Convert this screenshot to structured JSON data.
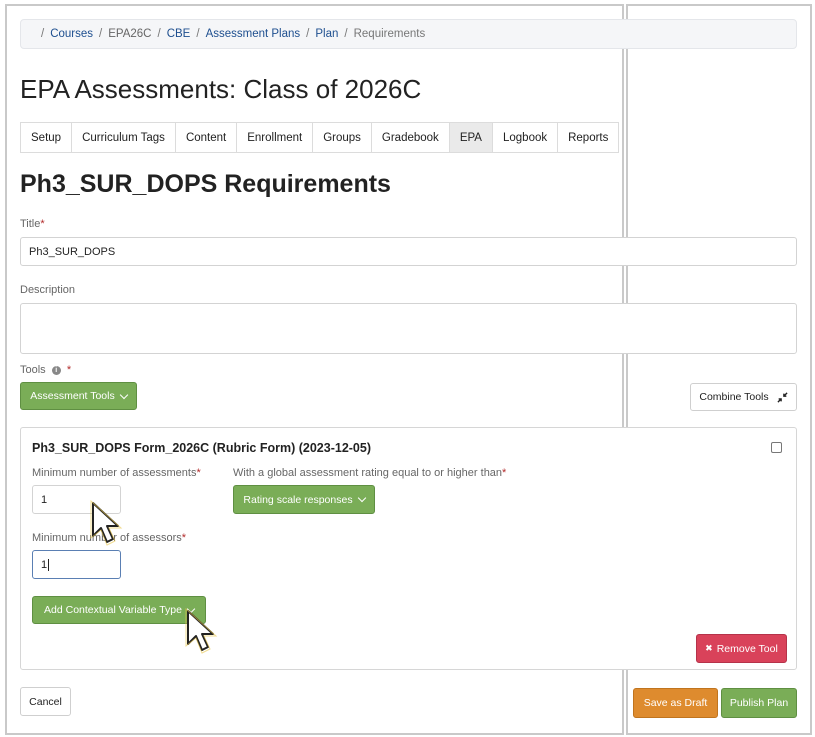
{
  "breadcrumb": {
    "items": [
      "Courses",
      "EPA26C",
      "CBE",
      "Assessment Plans",
      "Plan",
      "Requirements"
    ]
  },
  "page_title": "EPA Assessments: Class of 2026C",
  "tabs": [
    {
      "label": "Setup"
    },
    {
      "label": "Curriculum Tags"
    },
    {
      "label": "Content"
    },
    {
      "label": "Enrollment"
    },
    {
      "label": "Groups"
    },
    {
      "label": "Gradebook"
    },
    {
      "label": "EPA",
      "active": true
    },
    {
      "label": "Logbook"
    },
    {
      "label": "Reports"
    }
  ],
  "section_title": "Ph3_SUR_DOPS Requirements",
  "form": {
    "title_label": "Title",
    "title_value": "Ph3_SUR_DOPS",
    "description_label": "Description",
    "description_value": "",
    "tools_label": "Tools",
    "required_mark": "*",
    "info_glyph": "i"
  },
  "toolbar": {
    "assessment_tools_label": "Assessment Tools",
    "combine_tools_label": "Combine Tools"
  },
  "tool_card": {
    "title": "Ph3_SUR_DOPS Form_2026C (Rubric Form) (2023-12-05)",
    "min_assessments_label": "Minimum number of assessments",
    "min_assessments_value": "1",
    "global_rating_label": "With a global assessment rating equal to or higher than",
    "rating_button_label": "Rating scale responses",
    "min_assessors_label": "Minimum number of assessors",
    "min_assessors_value": "1",
    "add_contextual_label": "Add Contextual Variable Type",
    "remove_tool_label": "Remove Tool",
    "remove_glyph": "✖"
  },
  "footer": {
    "cancel_label": "Cancel",
    "save_draft_label": "Save as Draft",
    "publish_label": "Publish Plan"
  },
  "colors": {
    "green": "#7aad57",
    "red": "#d9425a",
    "orange": "#de8b2e",
    "link": "#1e4f8f"
  }
}
